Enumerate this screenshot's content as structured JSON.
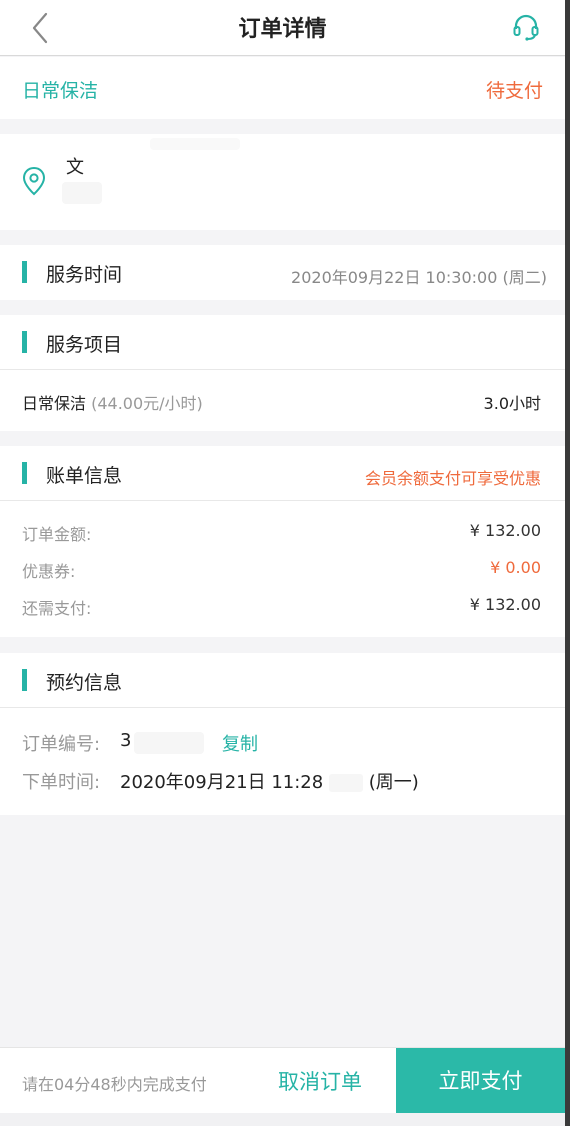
{
  "nav": {
    "title": "订单详情",
    "back_icon": "chevron-left-icon",
    "service_icon": "headset-icon"
  },
  "status": {
    "service_type": "日常保洁",
    "state": "待支付"
  },
  "address": {
    "icon": "location-pin-icon",
    "name": "文"
  },
  "service_time": {
    "title": "服务时间",
    "value": "2020年09月22日 10:30:00 (周二)"
  },
  "service_items": {
    "title": "服务项目",
    "items": [
      {
        "name": "日常保洁",
        "price": "(44.00元/小时)",
        "duration": "3.0小时"
      }
    ]
  },
  "billing": {
    "title": "账单信息",
    "promo": "会员余额支付可享受优惠",
    "rows": [
      {
        "label": "订单金额:",
        "value": "¥ 132.00"
      },
      {
        "label": "优惠券:",
        "value": "¥ 0.00"
      },
      {
        "label": "还需支付:",
        "value": "¥ 132.00"
      }
    ]
  },
  "booking": {
    "title": "预约信息",
    "order_no_label": "订单编号:",
    "order_no": "3",
    "copy_label": "复制",
    "order_time_label": "下单时间:",
    "order_time": "2020年09月21日 11:28",
    "order_weekday": "(周一)"
  },
  "bottom": {
    "countdown": "请在04分48秒内完成支付",
    "cancel": "取消订单",
    "pay": "立即支付"
  },
  "colors": {
    "accent": "#26b3a6",
    "warning": "#ef6a3c",
    "pay_button": "#2bb9a8"
  }
}
